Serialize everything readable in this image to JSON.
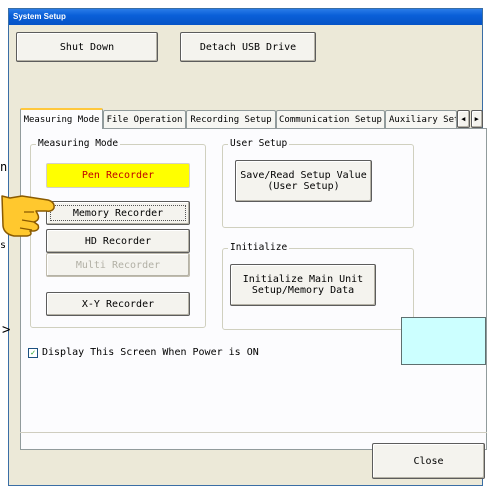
{
  "window": {
    "title": "System Setup"
  },
  "top_buttons": {
    "shut_down": "Shut Down",
    "detach_usb": "Detach USB Drive"
  },
  "tabs": [
    {
      "label": "Measuring Mode",
      "active": true
    },
    {
      "label": "File Operation",
      "active": false
    },
    {
      "label": "Recording Setup",
      "active": false
    },
    {
      "label": "Communication Setup",
      "active": false
    },
    {
      "label": "Auxiliary Setu",
      "active": false
    }
  ],
  "tab_scroll": {
    "left_icon": "arrow-left-icon",
    "right_icon": "arrow-right-icon"
  },
  "measuring_mode": {
    "legend": "Measuring Mode",
    "buttons": {
      "pen": "Pen Recorder",
      "memory": "Memory Recorder",
      "hd": "HD Recorder",
      "multi": "Multi Recorder",
      "xy": "X-Y Recorder"
    },
    "selected": "Pen Recorder",
    "highlight_color": "#ffff00"
  },
  "user_setup": {
    "legend": "User Setup",
    "button_line1": "Save/Read Setup Value",
    "button_line2": "(User Setup)"
  },
  "initialize": {
    "legend": "Initialize",
    "button_line1": "Initialize Main Unit",
    "button_line2": "Setup/Memory Data"
  },
  "checkbox": {
    "label": "Display This Screen When Power is ON",
    "checked": true
  },
  "close_button": "Close",
  "annotation": {
    "pointer_icon": "pointing-hand-icon",
    "callout_color": "#ccffff"
  }
}
